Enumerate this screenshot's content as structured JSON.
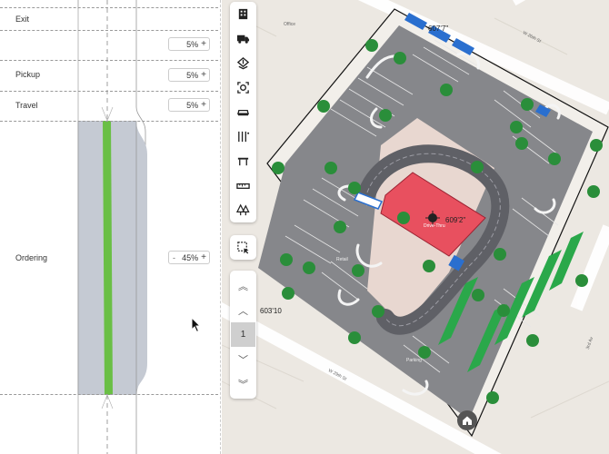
{
  "segments": {
    "exit": {
      "label": "Exit",
      "value": "5%"
    },
    "pickup": {
      "label": "Pickup",
      "value": "5%"
    },
    "travel": {
      "label": "Travel",
      "value": "5%"
    },
    "ordering": {
      "label": "Ordering",
      "value": "45%",
      "minus": "-"
    }
  },
  "stepper": {
    "plus": "+"
  },
  "toolbar": {
    "tools": [
      {
        "name": "building-icon"
      },
      {
        "name": "truck-icon"
      },
      {
        "name": "layers-icon"
      },
      {
        "name": "focus-icon"
      },
      {
        "name": "car-icon"
      },
      {
        "name": "parking-adjust-icon"
      },
      {
        "name": "table-icon"
      },
      {
        "name": "ruler-icon"
      },
      {
        "name": "trees-icon"
      }
    ],
    "select_tool": {
      "name": "select-area-icon"
    },
    "pager": {
      "current": "1",
      "first": "︽",
      "prev": "︿",
      "next": "﹀",
      "last": "︾"
    }
  },
  "map": {
    "dimension_top": "607'7\"",
    "dimension_building": "609'2\"",
    "dimension_left": "603'10",
    "building_label": "Drive-Thru",
    "retail_label": "Retail",
    "parking_label": "Parking",
    "streets": {
      "top": "W 26th St",
      "bottom": "W 29th St",
      "right": "3rd Av",
      "poi": "Office"
    }
  },
  "colors": {
    "lane": "#c5cad3",
    "lane_green": "#6abf45",
    "parking": "#86878b",
    "building": "#e8505f",
    "tree": "#2a8e3a",
    "queue": "#5f6066",
    "ev": "#2a6fcf",
    "green_stalls": "#2aa84a"
  }
}
